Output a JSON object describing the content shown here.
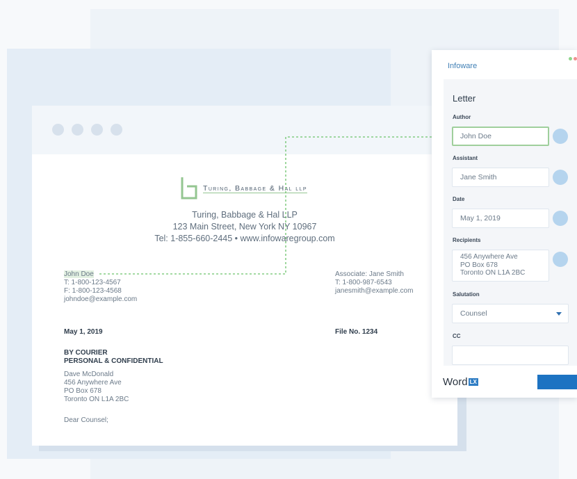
{
  "colors": {
    "accent": "#1d73c2",
    "logo_green": "#94c691",
    "connector": "#6cc36b",
    "title_blue": "#3f7fb5"
  },
  "document": {
    "logo_icon": "tbh-monogram-logo",
    "firm_logo_text": "Turing, Babbage & Hal llp",
    "firm_name": "Turing, Babbage & Hal LLP",
    "address": "123 Main Street, New York NY 10967",
    "contact": "Tel: 1-855-660-2445 • www.infowaregroup.com",
    "author": {
      "name": "John Doe",
      "phone": "T: 1-800-123-4567",
      "fax": "F: 1-800-123-4568",
      "email": "johndoe@example.com"
    },
    "associate": {
      "line": "Associate: Jane Smith",
      "phone": "T: 1-800-987-6543",
      "email": "janesmith@example.com"
    },
    "date": "May 1, 2019",
    "file_no": "File No. 1234",
    "delivery": "BY COURIER",
    "confidentiality": "PERSONAL & CONFIDENTIAL",
    "recipient": [
      "Dave McDonald",
      "456 Anywhere Ave",
      "PO Box 678",
      "Toronto ON L1A 2BC"
    ],
    "salutation": "Dear Counsel;"
  },
  "panel": {
    "title": "Infoware",
    "heading": "Letter",
    "fields": {
      "author": {
        "label": "Author",
        "value": "John Doe"
      },
      "assistant": {
        "label": "Assistant",
        "value": "Jane Smith"
      },
      "date": {
        "label": "Date",
        "value": "May 1, 2019"
      },
      "recipients": {
        "label": "Recipients",
        "lines": [
          "456 Anywhere Ave",
          "PO Box 678",
          "Toronto ON L1A 2BC"
        ]
      },
      "salutation": {
        "label": "Salutation",
        "value": "Counsel"
      },
      "cc": {
        "label": "CC",
        "value": ""
      }
    },
    "footer": {
      "word": "Word",
      "badge": "LX"
    }
  }
}
